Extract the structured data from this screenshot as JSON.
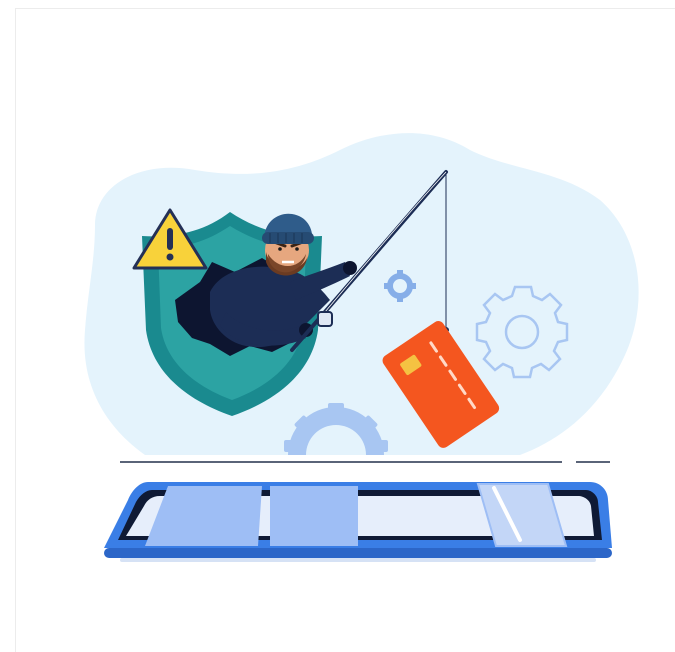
{
  "illustration": {
    "subject": "phishing",
    "colors": {
      "blob": "#e4f3fc",
      "shield_outer": "#1a8a8f",
      "shield_inner": "#2ca3a3",
      "hacker_body": "#1c2d55",
      "beanie": "#2f5c8a",
      "card": "#f4561f",
      "card_chip": "#f5c242",
      "warning": "#f8d23a",
      "gear": "#a8c6f2",
      "phone_frame": "#3a7ee6",
      "phone_screen": "#e6eefb",
      "panel": "#9ebef5"
    },
    "icons": [
      "warning-icon",
      "shield-icon",
      "gear-icon",
      "credit-card-icon",
      "fishing-rod-icon",
      "smartphone-icon"
    ]
  }
}
